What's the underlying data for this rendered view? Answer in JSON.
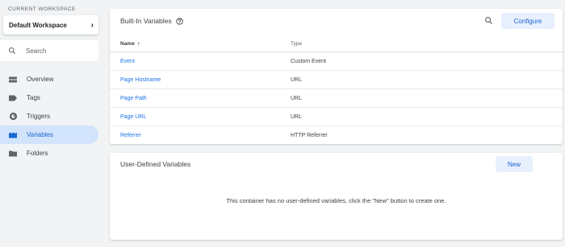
{
  "sidebar": {
    "workspace_caption": "CURRENT WORKSPACE",
    "workspace_name": "Default Workspace",
    "search_placeholder": "Search",
    "items": [
      {
        "label": "Overview",
        "icon": "overview-icon"
      },
      {
        "label": "Tags",
        "icon": "tag-icon"
      },
      {
        "label": "Triggers",
        "icon": "trigger-icon"
      },
      {
        "label": "Variables",
        "icon": "variables-icon",
        "active": true
      },
      {
        "label": "Folders",
        "icon": "folder-icon"
      }
    ],
    "accent": "#1967d2",
    "active_bg": "#d2e3fc"
  },
  "builtin": {
    "title": "Built-In Variables",
    "configure_label": "Configure",
    "columns": {
      "name": "Name",
      "type": "Type"
    },
    "rows": [
      {
        "name": "Event",
        "type": "Custom Event"
      },
      {
        "name": "Page Hostname",
        "type": "URL"
      },
      {
        "name": "Page Path",
        "type": "URL"
      },
      {
        "name": "Page URL",
        "type": "URL"
      },
      {
        "name": "Referrer",
        "type": "HTTP Referrer"
      }
    ]
  },
  "user_defined": {
    "title": "User-Defined Variables",
    "new_label": "New",
    "empty_message": "This container has no user-defined variables, click the \"New\" button to create one."
  }
}
